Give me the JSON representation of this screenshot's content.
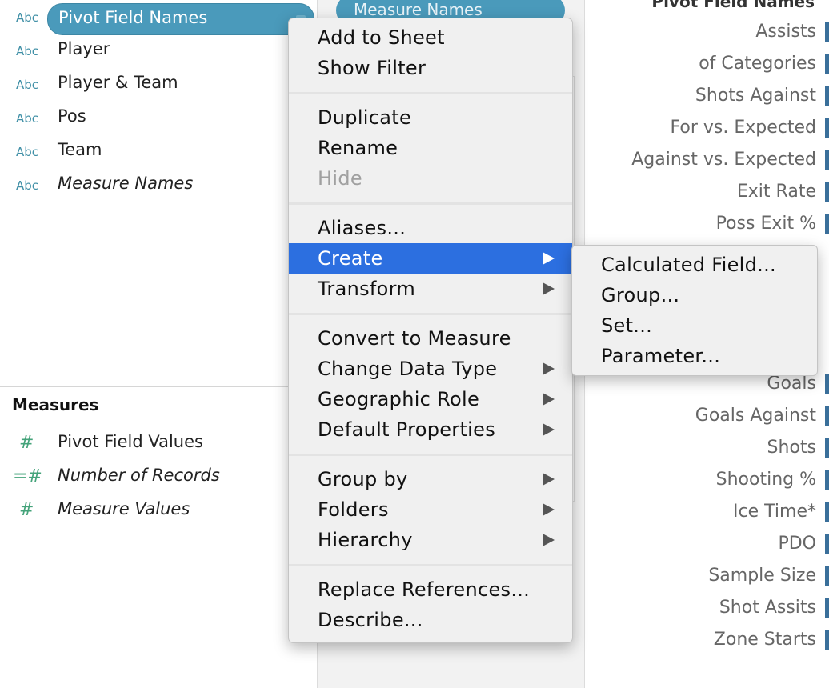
{
  "data_pane": {
    "dimensions": [
      {
        "type": "Abc",
        "label": "Pivot Field Names"
      },
      {
        "type": "Abc",
        "label": "Player"
      },
      {
        "type": "Abc",
        "label": "Player & Team"
      },
      {
        "type": "Abc",
        "label": "Pos"
      },
      {
        "type": "Abc",
        "label": "Team"
      },
      {
        "type": "Abc",
        "label": "Measure Names"
      }
    ],
    "measures_header": "Measures",
    "measures": [
      {
        "type": "#",
        "label": "Pivot Field Values"
      },
      {
        "type": "=#",
        "label": "Number of Records"
      },
      {
        "type": "#",
        "label": "Measure Values"
      }
    ]
  },
  "shelf": {
    "columns_pill": "Measure Names"
  },
  "header_column": {
    "title": "Pivot Field Names",
    "items": [
      "Assists",
      "of Categories",
      "Shots Against",
      "For vs. Expected",
      "Against vs. Expected",
      "Exit Rate",
      "Poss Exit %",
      "Goals",
      "Goals Against",
      "Shots",
      "Shooting %",
      "Ice Time*",
      "PDO",
      "Sample Size",
      "Shot Assits",
      "Zone Starts"
    ]
  },
  "context_menu": {
    "items": [
      {
        "label": "Add to Sheet"
      },
      {
        "label": "Show Filter"
      },
      {
        "label": "Duplicate"
      },
      {
        "label": "Rename"
      },
      {
        "label": "Hide",
        "state": "disabled"
      },
      {
        "label": "Aliases..."
      },
      {
        "label": "Create",
        "state": "highlighted"
      },
      {
        "label": "Transform"
      },
      {
        "label": "Convert to Measure"
      },
      {
        "label": "Change Data Type"
      },
      {
        "label": "Geographic Role"
      },
      {
        "label": "Default Properties"
      },
      {
        "label": "Group by"
      },
      {
        "label": "Folders"
      },
      {
        "label": "Hierarchy"
      },
      {
        "label": "Replace References..."
      },
      {
        "label": "Describe..."
      }
    ]
  },
  "submenu": {
    "items": [
      "Calculated Field...",
      "Group...",
      "Set...",
      "Parameter..."
    ]
  },
  "colors": {
    "pill": "#4a9abb",
    "menu_highlight": "#2c6fe0",
    "dimension_type": "#3f8fa6",
    "measure_type": "#44a37a"
  }
}
